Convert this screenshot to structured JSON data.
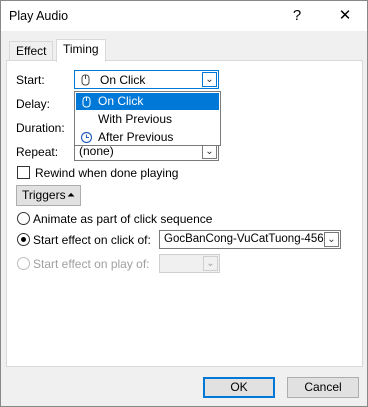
{
  "window": {
    "title": "Play Audio",
    "help_label": "?",
    "close_label": "✕"
  },
  "tabs": [
    {
      "label": "Effect",
      "active": false
    },
    {
      "label": "Timing",
      "active": true
    }
  ],
  "timing": {
    "start_label": "Start:",
    "start_value": "On Click",
    "start_options": [
      "On Click",
      "With Previous",
      "After Previous"
    ],
    "start_selected_option": "On Click",
    "delay_label": "Delay:",
    "duration_label": "Duration:",
    "repeat_label": "Repeat:",
    "repeat_value": "(none)",
    "rewind_label": "Rewind when done playing",
    "rewind_checked": false,
    "triggers_label": "Triggers",
    "triggers_icon": "double-chevron-up-icon",
    "animate_sequence_label": "Animate as part of click sequence",
    "start_on_click_of_label": "Start effect on click of:",
    "start_on_click_of_value": "GocBanCong-VuCatTuong-456",
    "start_on_play_of_label": "Start effect on play of:",
    "start_on_play_of_value": ""
  },
  "footer": {
    "ok_label": "OK",
    "cancel_label": "Cancel"
  },
  "colors": {
    "accent": "#0078d7",
    "background": "#f0f0f0"
  }
}
